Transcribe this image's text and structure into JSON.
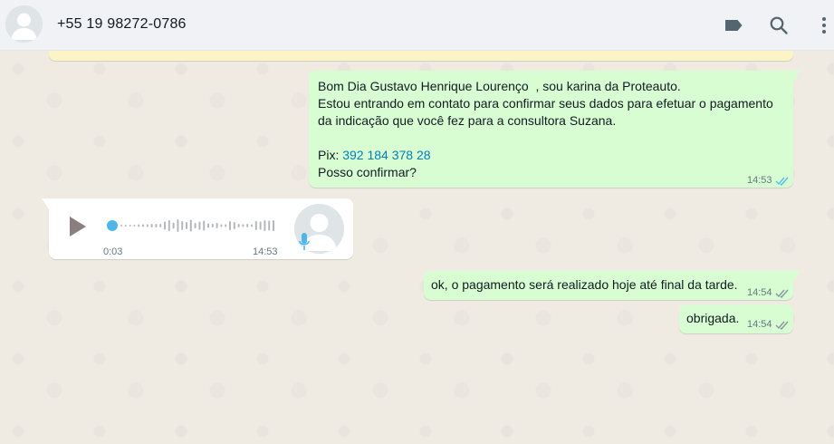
{
  "header": {
    "contact_name": "+55 19 98272-0786",
    "icons": [
      "avatar-default-icon",
      "label-icon",
      "search-icon",
      "menu-icon"
    ]
  },
  "colors": {
    "outgoing_bubble": "#d9fdd3",
    "incoming_bubble": "#ffffff",
    "read_ticks": "#53bdeb",
    "link": "#027eb5",
    "chat_bg": "#efeae2"
  },
  "messages": {
    "msg1": {
      "line1": "Bom Dia Gustavo Henrique Lourenço  , sou karina da Proteauto.",
      "line2": "Estou entrando em contato para confirmar seus dados para efetuar o pagamento da indicação que você fez para a consultora Suzana.",
      "pix_label": "Pix: ",
      "pix_number": "392 184 378 28",
      "line4": "Posso confirmar?",
      "time": "14:53",
      "status": "read"
    },
    "voice": {
      "duration": "0:03",
      "time": "14:53",
      "progress": 0
    },
    "msg2": {
      "text": "ok, o pagamento será realizado hoje até final da tarde.",
      "time": "14:54",
      "status": "delivered"
    },
    "msg3": {
      "text": "obrigada.",
      "time": "14:54",
      "status": "delivered"
    }
  }
}
